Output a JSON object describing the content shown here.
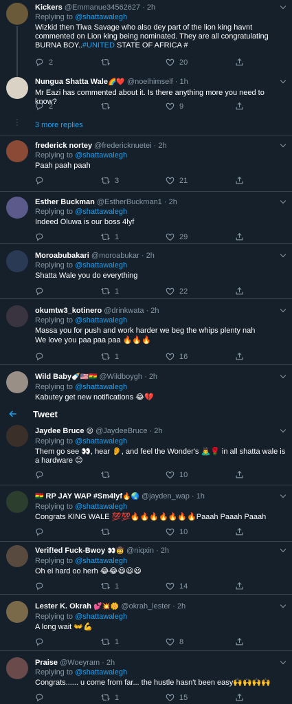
{
  "header": {
    "title": "Tweet",
    "back_icon": "arrow-left-icon"
  },
  "thread": {
    "more_replies": "3 more replies"
  },
  "replying_label": "Replying to",
  "tweets": [
    {
      "name": "Kickers",
      "handle": "@Emmanue34562627",
      "time": "2h",
      "reply_to": "@shattawalegh",
      "text": "Wizkid then Tiwa Savage who also dey part of the lion king havnt commented on Lion king being nominated. They are all congratulating BURNA BOY..",
      "link": "#UNITED",
      "text_after": " STATE OF AFRICA #",
      "replies": "2",
      "retweets": "",
      "likes": "20",
      "avatar_color": "#6b5a3a"
    },
    {
      "name": "Nungua Shatta Wale",
      "handle": "@noelhimself",
      "time": "1h",
      "name_emoji": "🌈❤️",
      "text": "Mr Eazi has commented about it. Is there anything more you need to know?",
      "replies": "2",
      "retweets": "",
      "likes": "9",
      "avatar_color": "#d9d2c5"
    },
    {
      "name": "frederick nortey",
      "handle": "@fredericknuetei",
      "time": "2h",
      "reply_to": "@shattawalegh",
      "text": "Paah paah paah",
      "replies": "",
      "retweets": "3",
      "likes": "21",
      "avatar_color": "#8a4a36"
    },
    {
      "name": "Esther Buckman",
      "handle": "@EstherBuckman1",
      "time": "2h",
      "reply_to": "@shattawalegh",
      "text": "Indeed Oluwa is our boss 4lyf",
      "replies": "",
      "retweets": "1",
      "likes": "29",
      "avatar_color": "#5b5a8a"
    },
    {
      "name": "Moroabubakari",
      "handle": "@moroabukar",
      "time": "2h",
      "reply_to": "@shattawalegh",
      "text": "Shatta Wale you do everything",
      "replies": "",
      "retweets": "1",
      "likes": "22",
      "avatar_color": "#2a3a55"
    },
    {
      "name": "okumtw3_kotinero",
      "handle": "@drinkwata",
      "time": "2h",
      "reply_to": "@shattawalegh",
      "text": "Massa you for push and work harder we beg the whips plenty nah",
      "text2": "We love you paa paa paa 🔥🔥🔥",
      "replies": "",
      "retweets": "1",
      "likes": "16",
      "avatar_color": "#3a3340"
    },
    {
      "name": "Wild Baby",
      "name_emoji": "🍼🇺🇸🇬🇭",
      "handle": "@Wildboygh",
      "time": "2h",
      "reply_to": "@shattawalegh",
      "text": "Kabutey get new notifications 😂💔",
      "avatar_color": "#9a8f86"
    },
    {
      "name": "Jaydee Bruce",
      "name_emoji": "😫",
      "handle": "@JaydeeBruce",
      "time": "2h",
      "reply_to": "@shattawalegh",
      "text": "Them go see 👀, hear 👂, and feel the Wonder's 🙇‍♂️🌹 in all shatta wale is a hardware 😊",
      "replies": "",
      "retweets": "",
      "likes": "10",
      "avatar_color": "#3b2f2a"
    },
    {
      "name": "RP JAY WAP #Sm4lyf",
      "name_prefix": "🇬🇭",
      "name_emoji": "🔥🌏",
      "handle": "@jayden_wap",
      "time": "1h",
      "reply_to": "@shattawalegh",
      "text": "Congrats KING WALE 💯💯🔥🔥🔥🔥🔥🔥🔥Paaah Paaah Paaah",
      "replies": "",
      "retweets": "",
      "likes": "10",
      "avatar_color": "#2c3f2f"
    },
    {
      "name": "Verif!ed Fuck-Bwoy",
      "name_emoji": "👀🤠",
      "handle": "@niqxin",
      "time": "2h",
      "reply_to": "@shattawalegh",
      "text": "Oh ei hard oo herh 😂😂😃😃😃",
      "replies": "",
      "retweets": "1",
      "likes": "14",
      "avatar_color": "#584a3e"
    },
    {
      "name": "Lester K. Okrah",
      "name_emoji": "💕💥🌼",
      "handle": "@okrah_lester",
      "time": "2h",
      "reply_to": "@shattawalegh",
      "text": "A long wait 👐💪",
      "replies": "",
      "retweets": "1",
      "likes": "8",
      "avatar_color": "#7a6a4a"
    },
    {
      "name": "Praise",
      "handle": "@Woeyram",
      "time": "2h",
      "reply_to": "@shattawalegh",
      "text": "Congrats...... u come from far... the hustle hasn't been easy🙌🙌🙌🙌",
      "replies": "",
      "retweets": "1",
      "likes": "15",
      "avatar_color": "#6a4a4a"
    }
  ]
}
